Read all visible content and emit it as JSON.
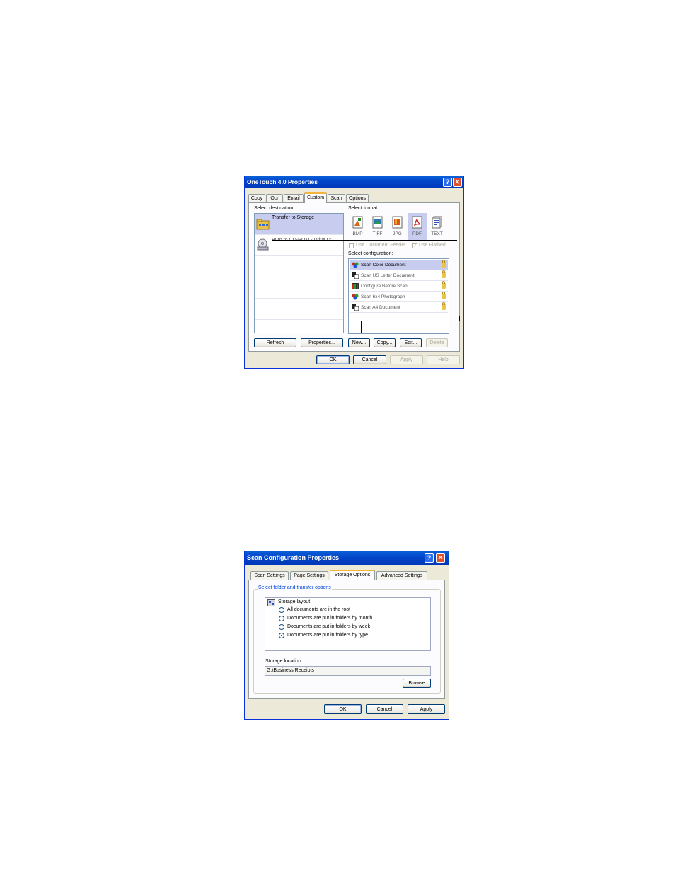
{
  "dialog1": {
    "title": "OneTouch 4.0 Properties",
    "help_glyph": "?",
    "close_glyph": "✕",
    "tabs": [
      {
        "label": "Copy"
      },
      {
        "label": "Ocr"
      },
      {
        "label": "Email"
      },
      {
        "label": "Custom"
      },
      {
        "label": "Scan"
      },
      {
        "label": "Options"
      }
    ],
    "active_tab": "Custom",
    "select_destination_label": "Select destination:",
    "destinations": [
      {
        "label": "Transfer to Storage",
        "icon": "storage-folder-icon"
      },
      {
        "label": "Burn to CD-ROM - Drive D:",
        "icon": "cd-burner-icon"
      }
    ],
    "select_format_label": "Select format:",
    "formats": [
      {
        "label": "BMP",
        "icon": "bmp-icon"
      },
      {
        "label": "TIFF",
        "icon": "tiff-icon"
      },
      {
        "label": "JPG",
        "icon": "jpg-icon"
      },
      {
        "label": "PDF",
        "icon": "pdf-icon"
      },
      {
        "label": "TEXT",
        "icon": "text-icon"
      }
    ],
    "selected_format": "PDF",
    "use_document_feeder_label": "Use Document Feeder",
    "use_flatbed_label": "Use Flatbed",
    "select_configuration_label": "Select configuration:",
    "configurations": [
      {
        "label": "Scan Color Document",
        "icon": "color-scan-icon"
      },
      {
        "label": "Scan US Letter Document",
        "icon": "bw-scan-icon"
      },
      {
        "label": "Configure Before Scan",
        "icon": "configure-icon"
      },
      {
        "label": "Scan 6x4 Photograph",
        "icon": "color-scan-icon"
      },
      {
        "label": "Scan A4 Document",
        "icon": "bw-scan-icon"
      }
    ],
    "selected_configuration": "Scan Color Document",
    "buttons": {
      "refresh": "Refresh",
      "properties": "Properties...",
      "new": "New...",
      "copy": "Copy...",
      "edit": "Edit...",
      "delete": "Delete",
      "ok": "OK",
      "cancel": "Cancel",
      "apply": "Apply",
      "help": "Help"
    }
  },
  "dialog2": {
    "title": "Scan Configuration Properties",
    "help_glyph": "?",
    "close_glyph": "✕",
    "tabs": [
      {
        "label": "Scan Settings"
      },
      {
        "label": "Page Settings"
      },
      {
        "label": "Storage Options"
      },
      {
        "label": "Advanced Settings"
      }
    ],
    "active_tab": "Storage Options",
    "group_title": "Select folder and transfer options",
    "storage_layout_label": "Storage layout",
    "options": [
      {
        "label": "All documents are in the root",
        "selected": false
      },
      {
        "label": "Documents are put in folders by month",
        "selected": false
      },
      {
        "label": "Documents are put in folders by week",
        "selected": false
      },
      {
        "label": "Documents are put in folders by type",
        "selected": true
      }
    ],
    "storage_location_label": "Storage location",
    "storage_location_value": "G:\\Business Receipts",
    "buttons": {
      "browse": "Browse",
      "ok": "OK",
      "cancel": "Cancel",
      "apply": "Apply"
    }
  }
}
